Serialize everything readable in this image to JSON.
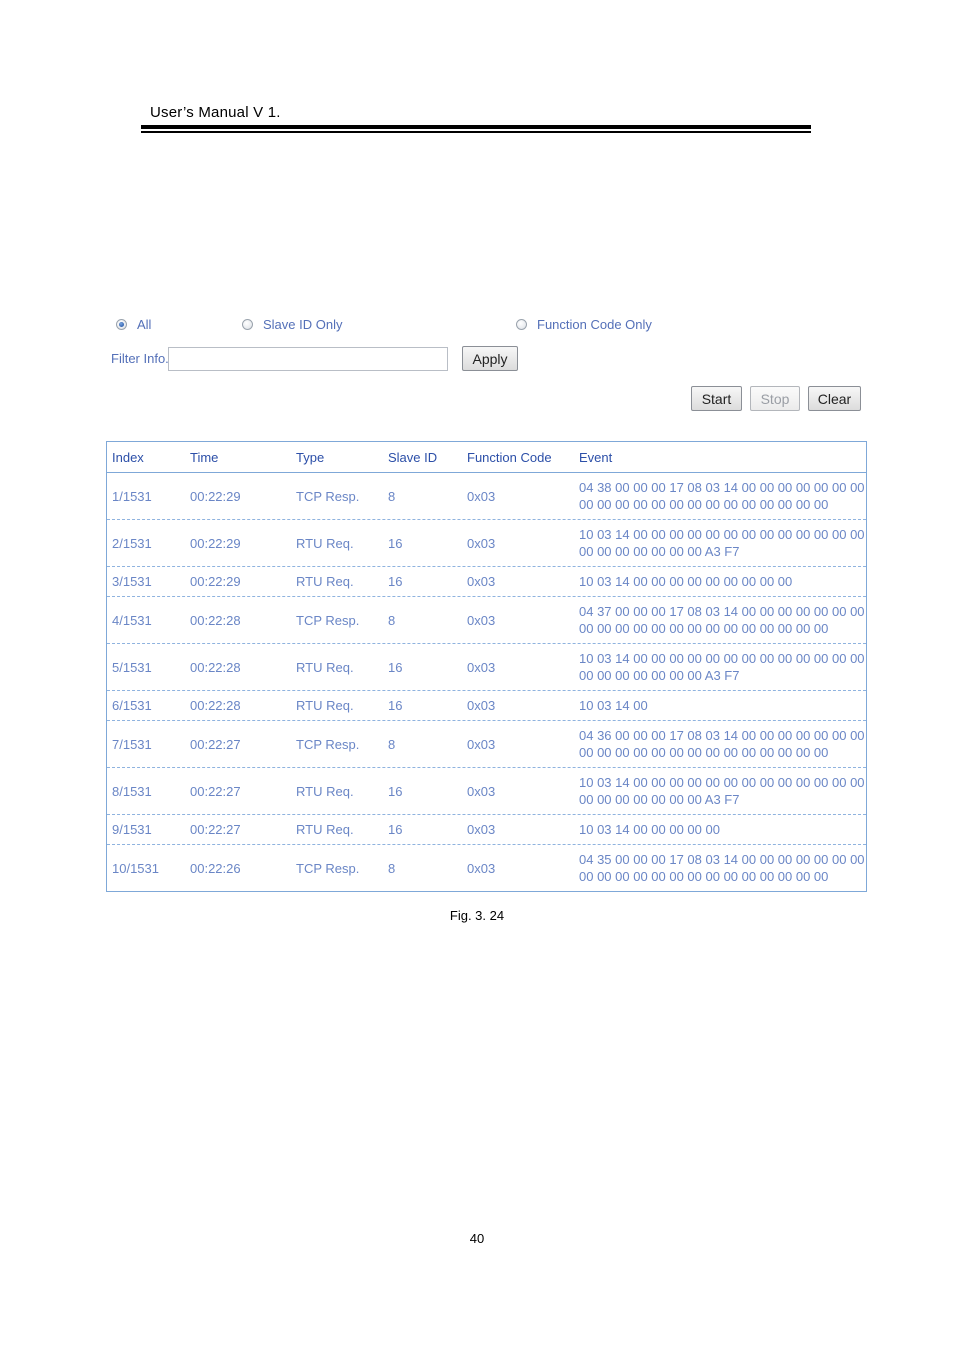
{
  "header": {
    "title": "User’s Manual V 1."
  },
  "filters": {
    "radios": [
      {
        "label": "All",
        "checked": true
      },
      {
        "label": "Slave ID Only",
        "checked": false
      },
      {
        "label": "Function Code Only",
        "checked": false
      }
    ],
    "filter_label": "Filter Info.",
    "filter_value": "",
    "apply_label": "Apply"
  },
  "controls": {
    "start_label": "Start",
    "stop_label": "Stop",
    "clear_label": "Clear"
  },
  "table": {
    "columns": [
      "Index",
      "Time",
      "Type",
      "Slave ID",
      "Function Code",
      "Event"
    ],
    "rows": [
      {
        "index": "1/1531",
        "time": "00:22:29",
        "type": "TCP Resp.",
        "slave_id": "8",
        "function_code": "0x03",
        "event": [
          "04 38 00 00 00 17 08 03 14 00 00 00 00 00 00 00",
          "00 00 00 00 00 00 00 00 00 00 00 00 00 00"
        ]
      },
      {
        "index": "2/1531",
        "time": "00:22:29",
        "type": "RTU Req.",
        "slave_id": "16",
        "function_code": "0x03",
        "event": [
          "10 03 14 00 00 00 00 00 00 00 00 00 00 00 00 00",
          "00 00 00 00 00 00 00 A3 F7"
        ]
      },
      {
        "index": "3/1531",
        "time": "00:22:29",
        "type": "RTU Req.",
        "slave_id": "16",
        "function_code": "0x03",
        "event": [
          "10 03 14 00 00 00 00 00 00 00 00 00"
        ]
      },
      {
        "index": "4/1531",
        "time": "00:22:28",
        "type": "TCP Resp.",
        "slave_id": "8",
        "function_code": "0x03",
        "event": [
          "04 37 00 00 00 17 08 03 14 00 00 00 00 00 00 00",
          "00 00 00 00 00 00 00 00 00 00 00 00 00 00"
        ]
      },
      {
        "index": "5/1531",
        "time": "00:22:28",
        "type": "RTU Req.",
        "slave_id": "16",
        "function_code": "0x03",
        "event": [
          "10 03 14 00 00 00 00 00 00 00 00 00 00 00 00 00",
          "00 00 00 00 00 00 00 A3 F7"
        ]
      },
      {
        "index": "6/1531",
        "time": "00:22:28",
        "type": "RTU Req.",
        "slave_id": "16",
        "function_code": "0x03",
        "event": [
          "10 03 14 00"
        ]
      },
      {
        "index": "7/1531",
        "time": "00:22:27",
        "type": "TCP Resp.",
        "slave_id": "8",
        "function_code": "0x03",
        "event": [
          "04 36 00 00 00 17 08 03 14 00 00 00 00 00 00 00",
          "00 00 00 00 00 00 00 00 00 00 00 00 00 00"
        ]
      },
      {
        "index": "8/1531",
        "time": "00:22:27",
        "type": "RTU Req.",
        "slave_id": "16",
        "function_code": "0x03",
        "event": [
          "10 03 14 00 00 00 00 00 00 00 00 00 00 00 00 00",
          "00 00 00 00 00 00 00 A3 F7"
        ]
      },
      {
        "index": "9/1531",
        "time": "00:22:27",
        "type": "RTU Req.",
        "slave_id": "16",
        "function_code": "0x03",
        "event": [
          "10 03 14 00 00 00 00 00"
        ]
      },
      {
        "index": "10/1531",
        "time": "00:22:26",
        "type": "TCP Resp.",
        "slave_id": "8",
        "function_code": "0x03",
        "event": [
          "04 35 00 00 00 17 08 03 14 00 00 00 00 00 00 00",
          "00 00 00 00 00 00 00 00 00 00 00 00 00 00"
        ]
      }
    ]
  },
  "caption": "Fig. 3. 24",
  "page_number": "40"
}
